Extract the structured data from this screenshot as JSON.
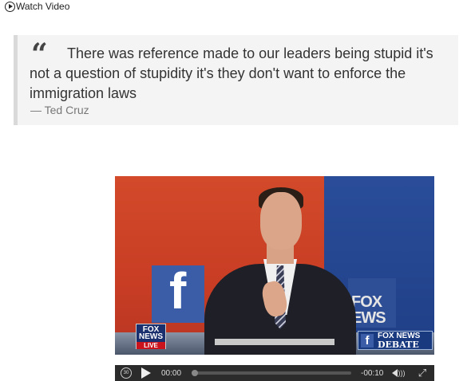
{
  "watch_video": {
    "label": "Watch Video",
    "icon": "play-circle-icon"
  },
  "quote": {
    "mark": "“",
    "text": "There was reference made to our leaders being stupid it's not a question of stupidity it's they don't want to enforce the immigration laws",
    "author": "— Ted Cruz"
  },
  "video": {
    "bug_left_line1": "FOX NEWS",
    "bug_left_line2": "LIVE",
    "bug_right_line1": "FOX NEWS",
    "bug_right_line2": "DEBATE",
    "screen_text": "FOX\nEWS",
    "fb_letter": "f"
  },
  "player": {
    "rewind_label": "30",
    "current_time": "00:00",
    "remaining_time": "-00:10",
    "progress": 0.0
  },
  "colors": {
    "quote_bg": "#f4f4f4",
    "quote_border": "#d9d9d9",
    "controls_bg": "#2b2b2b",
    "stage_red": "#c83d24",
    "stage_blue": "#1f3f86"
  }
}
